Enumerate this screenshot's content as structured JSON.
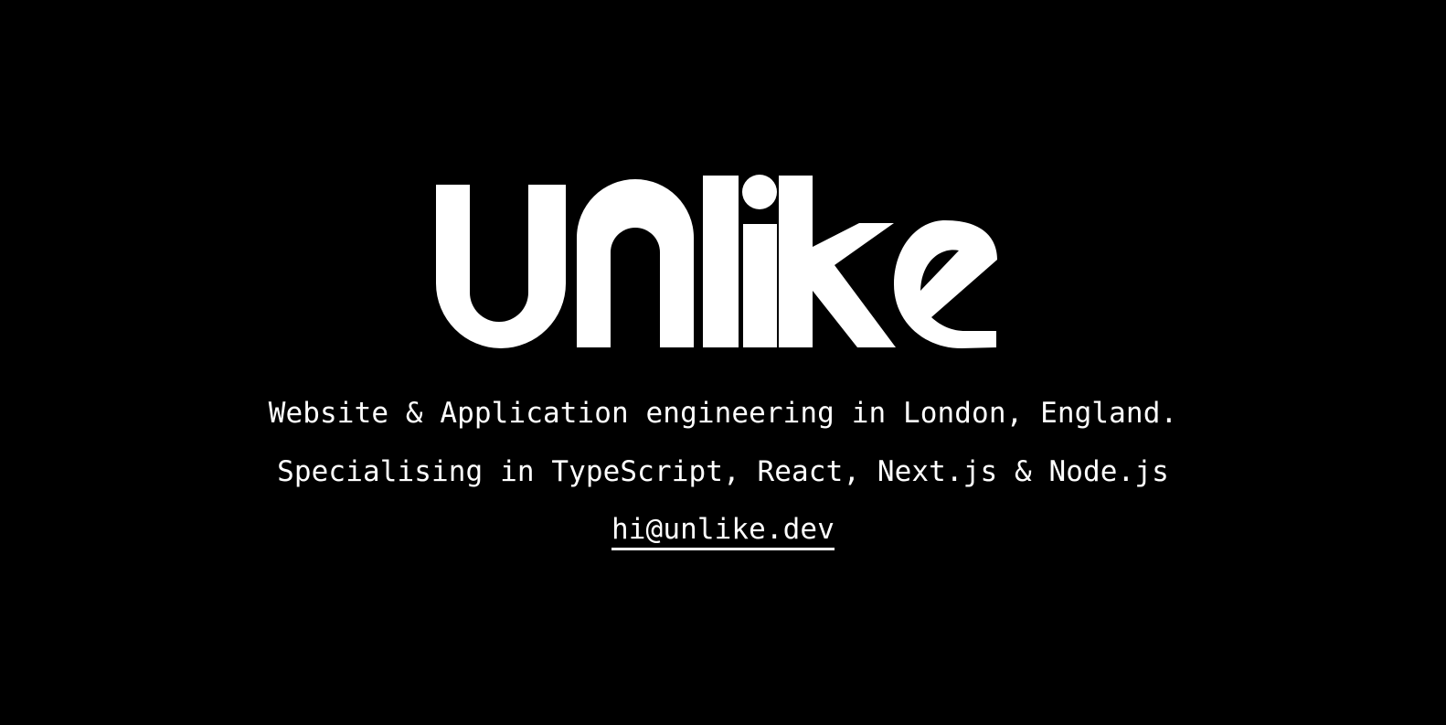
{
  "logo": {
    "text": "Unlike"
  },
  "tagline": "Website & Application engineering in London, England.",
  "specialties": "Specialising in TypeScript, React, Next.js & Node.js",
  "contact": {
    "email": "hi@unlike.dev",
    "href": "mailto:hi@unlike.dev"
  },
  "colors": {
    "background": "#000000",
    "text": "#ffffff"
  }
}
